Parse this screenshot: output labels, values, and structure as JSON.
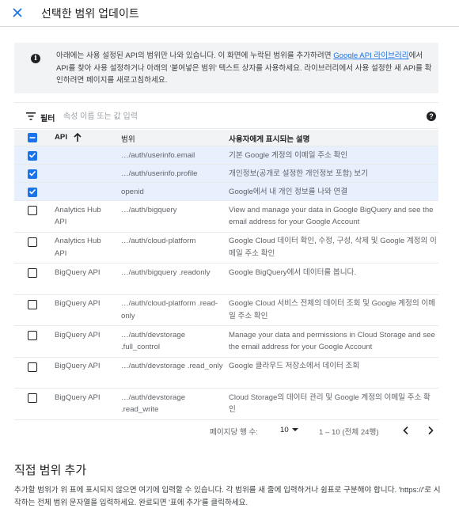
{
  "header": {
    "title": "선택한 범위 업데이트",
    "close_icon": "close-icon"
  },
  "info": {
    "text_before": "아래에는 사용 설정된 API의 범위만 나와 있습니다. 이 화면에 누락된 범위를 추가하려면 ",
    "link": "Google API 라이브러리",
    "text_after": "에서 API를 찾아 사용 설정하거나 아래의 '붙여넣은 범위' 텍스트 상자를 사용하세요. 라이브러리에서 사용 설정한 새 API를 확인하려면 페이지를 새로고침하세요."
  },
  "filter": {
    "label": "필터",
    "placeholder": "속성 이름 또는 값 입력"
  },
  "table": {
    "headers": {
      "api": "API",
      "scope": "범위",
      "desc": "사용자에게 표시되는 설명"
    },
    "rows": [
      {
        "checked": true,
        "api": "",
        "scope": "…/auth/userinfo.email",
        "desc": "기본 Google 계정의 이메일 주소 확인"
      },
      {
        "checked": true,
        "api": "",
        "scope": "…/auth/userinfo.profile",
        "desc": "개인정보(공개로 설정한 개인정보 포함) 보기"
      },
      {
        "checked": true,
        "api": "",
        "scope": "openid",
        "desc": "Google에서 내 개인 정보를 나와 연결"
      },
      {
        "checked": false,
        "api": "Analytics Hub API",
        "scope": "…/auth/bigquery",
        "desc": "View and manage your data in Google BigQuery and see the email address for your Google Account"
      },
      {
        "checked": false,
        "api": "Analytics Hub API",
        "scope": "…/auth/cloud-platform",
        "desc": "Google Cloud 데이터 확인, 수정, 구성, 삭제 및 Google 계정의 이메일 주소 확인"
      },
      {
        "checked": false,
        "api": "BigQuery API",
        "scope": "…/auth/bigquery .readonly",
        "desc": "Google BigQuery에서 데이터를 봅니다."
      },
      {
        "checked": false,
        "api": "BigQuery API",
        "scope": "…/auth/cloud-platform .read-only",
        "desc": "Google Cloud 서비스 전체의 데이터 조회 및 Google 계정의 이메일 주소 확인"
      },
      {
        "checked": false,
        "api": "BigQuery API",
        "scope": "…/auth/devstorage .full_control",
        "desc": "Manage your data and permissions in Cloud Storage and see the email address for your Google Account"
      },
      {
        "checked": false,
        "api": "BigQuery API",
        "scope": "…/auth/devstorage .read_only",
        "desc": "Google 클라우드 저장소에서 데이터 조회"
      },
      {
        "checked": false,
        "api": "BigQuery API",
        "scope": "…/auth/devstorage .read_write",
        "desc": "Cloud Storage의 데이터 관리 및 Google 계정의 이메일 주소 확인"
      }
    ]
  },
  "pager": {
    "label": "페이지당 행 수:",
    "per_page": "10",
    "range": "1 – 10 (전체 24행)"
  },
  "manual": {
    "title": "직접 범위 추가",
    "desc": "추가할 범위가 위 표에 표시되지 않으면 여기에 입력할 수 있습니다. 각 범위를 새 줄에 입력하거나 쉼표로 구분해야 합니다. 'https://'로 시작하는 전체 범위 문자열을 입력하세요. 완료되면 '표에 추가'를 클릭하세요."
  },
  "colors": {
    "accent": "#1a73e8",
    "selected_row": "#e8f0fe",
    "header_bg": "#f1f3f4"
  }
}
